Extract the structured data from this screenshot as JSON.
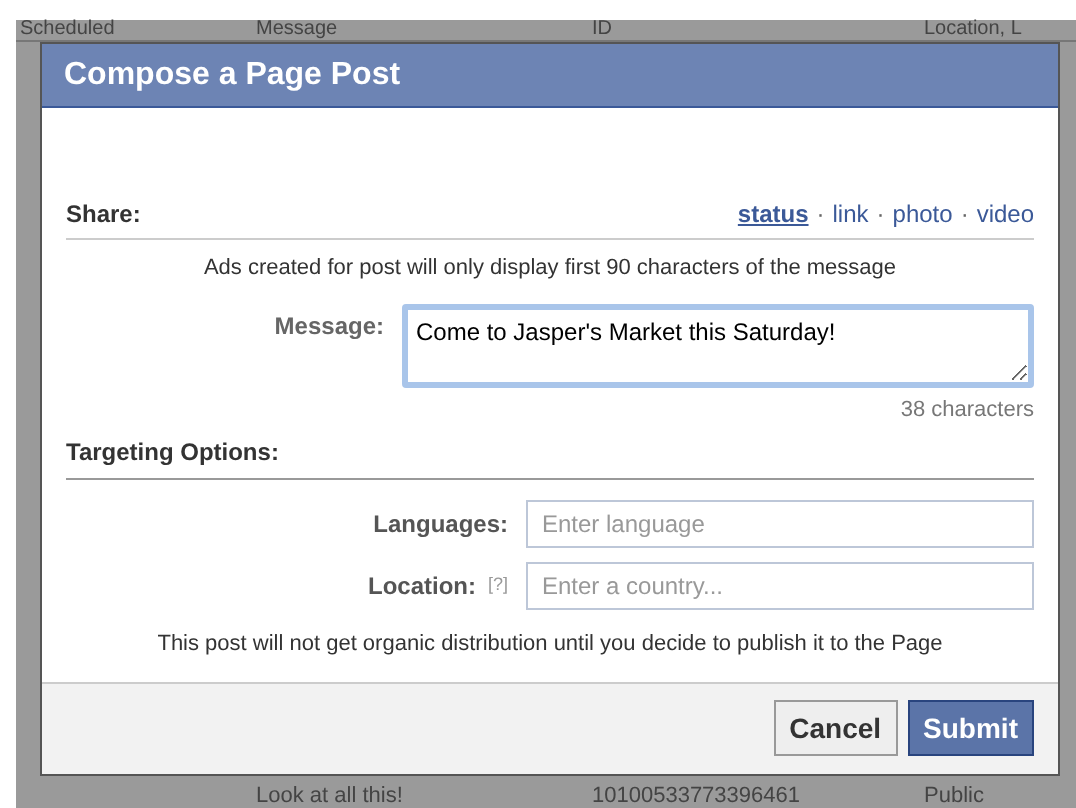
{
  "background_table": {
    "columns": [
      "Scheduled",
      "Message",
      "ID",
      "Location, L"
    ],
    "rows": [
      [
        "",
        "Look at all this!",
        "10100533773396461",
        "Public"
      ]
    ]
  },
  "dialog": {
    "title": "Compose a Page Post",
    "share": {
      "label": "Share:",
      "options": [
        {
          "label": "status",
          "selected": true
        },
        {
          "label": "link",
          "selected": false
        },
        {
          "label": "photo",
          "selected": false
        },
        {
          "label": "video",
          "selected": false
        }
      ],
      "separator": "·"
    },
    "ads_note": "Ads created for post will only display first 90 characters of the message",
    "message": {
      "label": "Message:",
      "value": "Come to Jasper's Market this Saturday!",
      "count": "38 characters"
    },
    "targeting": {
      "title": "Targeting Options:",
      "fields": [
        {
          "label": "Languages:",
          "placeholder": "Enter language"
        },
        {
          "label": "Location:",
          "help": "[?]",
          "placeholder": "Enter a country..."
        }
      ]
    },
    "notice": "This post will not get organic distribution until you decide to publish it to the Page",
    "buttons": [
      {
        "label": "Cancel",
        "kind": "secondary"
      },
      {
        "label": "Submit",
        "kind": "primary"
      }
    ]
  }
}
